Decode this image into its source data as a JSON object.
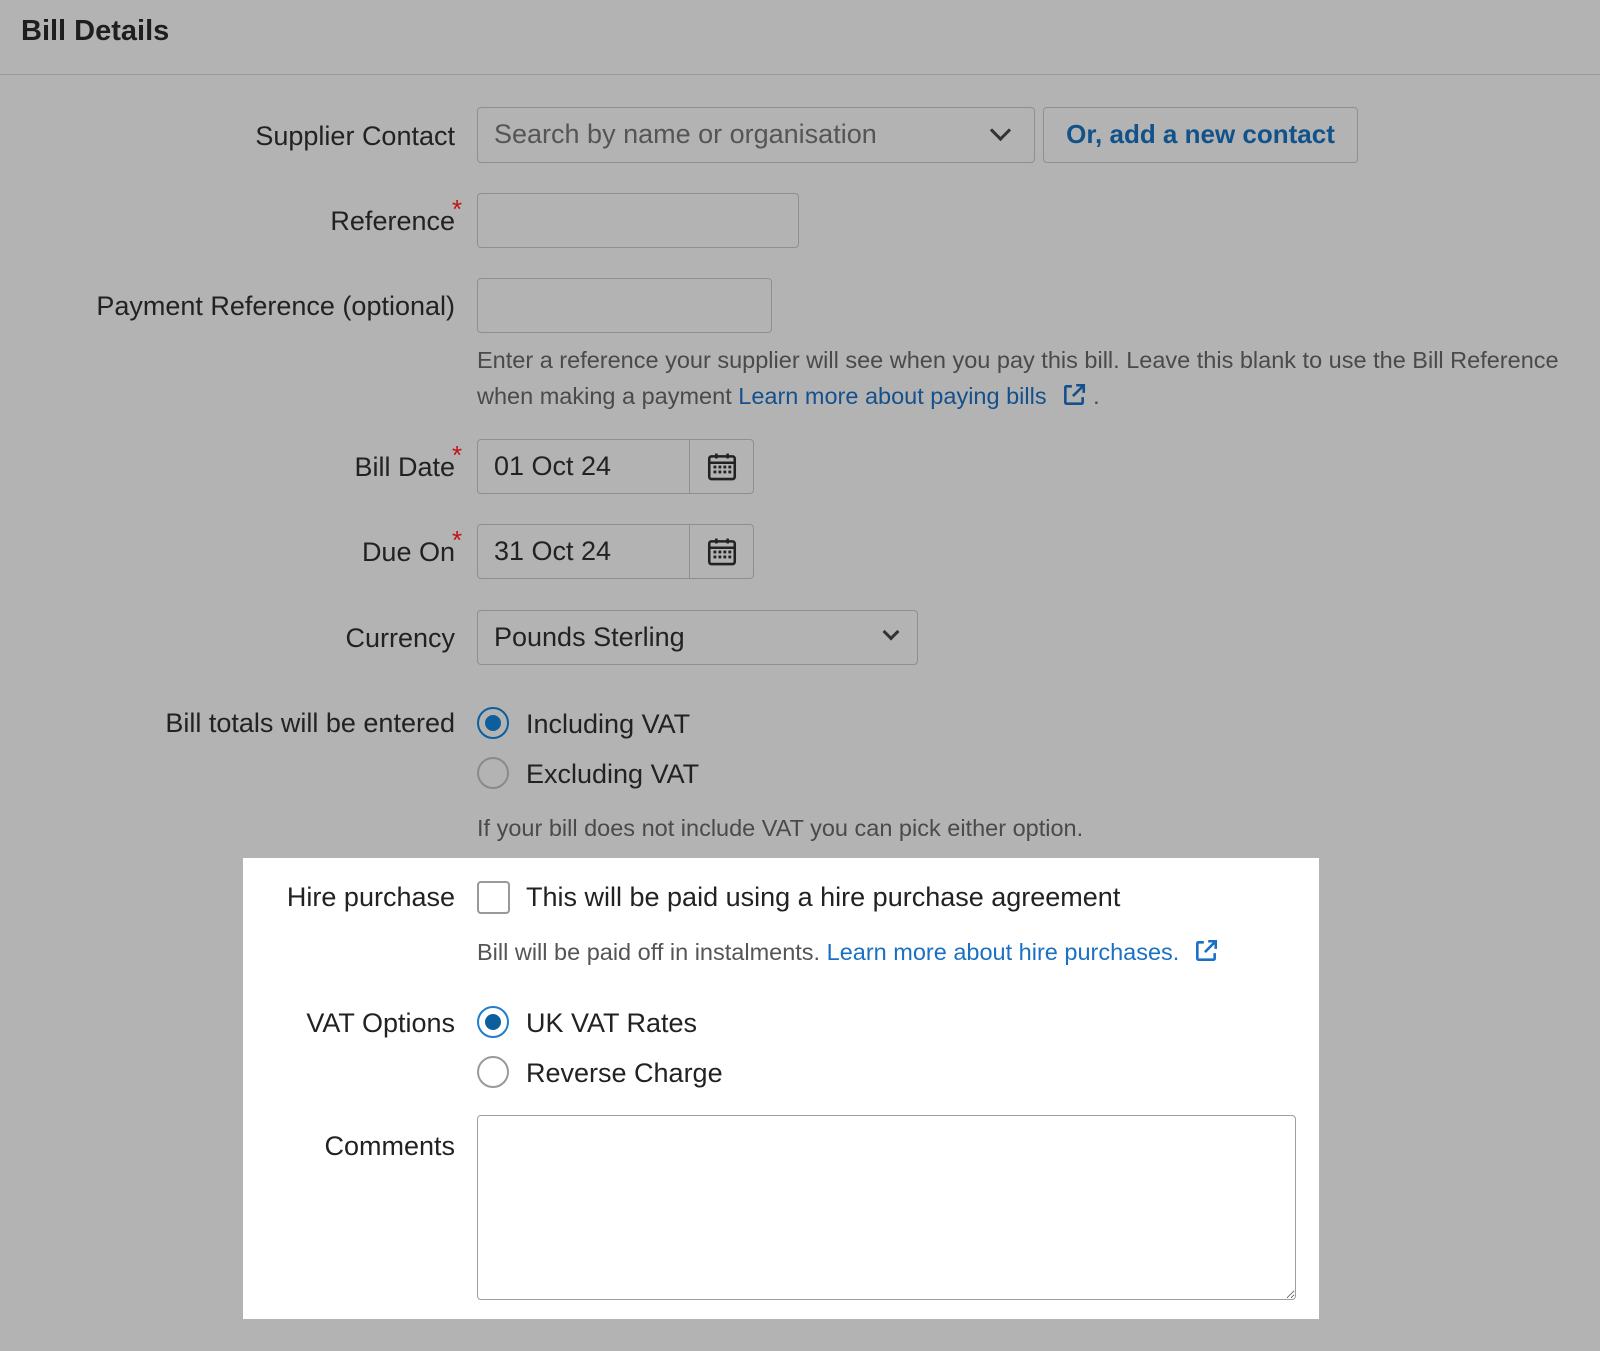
{
  "header": {
    "title": "Bill Details"
  },
  "supplier": {
    "label": "Supplier Contact",
    "placeholder": "Search by name or organisation",
    "add_contact_label": "Or, add a new contact"
  },
  "reference": {
    "label": "Reference",
    "required_mark": "*",
    "value": ""
  },
  "payment_reference": {
    "label": "Payment Reference (optional)",
    "value": "",
    "help_text": "Enter a reference your supplier will see when you pay this bill. Leave this blank to use the Bill Reference when making a payment",
    "help_link": "Learn more about paying bills",
    "help_suffix": "."
  },
  "bill_date": {
    "label": "Bill Date",
    "required_mark": "*",
    "value": "01 Oct 24"
  },
  "due_on": {
    "label": "Due On",
    "required_mark": "*",
    "value": "31 Oct 24"
  },
  "currency": {
    "label": "Currency",
    "value": "Pounds Sterling"
  },
  "bill_totals": {
    "label": "Bill totals will be entered",
    "options": [
      "Including VAT",
      "Excluding VAT"
    ],
    "selected": "Including VAT",
    "help_text": "If your bill does not include VAT you can pick either option."
  },
  "hire_purchase": {
    "label": "Hire purchase",
    "checkbox_label": "This will be paid using a hire purchase agreement",
    "checked": false,
    "help_text": "Bill will be paid off in instalments.",
    "help_link": "Learn more about hire purchases."
  },
  "vat_options": {
    "label": "VAT Options",
    "options": [
      "UK VAT Rates",
      "Reverse Charge"
    ],
    "selected": "UK VAT Rates"
  },
  "comments": {
    "label": "Comments",
    "value": ""
  },
  "colors": {
    "background": "#b3b3b3",
    "link": "#15508c",
    "required": "#c41111",
    "radio_selected": "#1f7ed0"
  },
  "icons": {
    "dropdown": "chevron-down-icon",
    "calendar": "calendar-icon",
    "external_link": "external-link-icon"
  }
}
